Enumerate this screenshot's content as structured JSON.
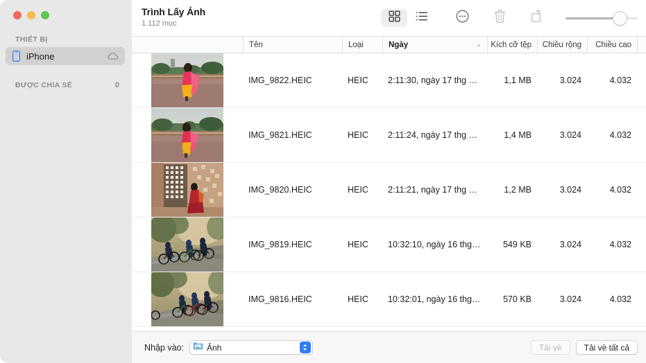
{
  "window": {
    "traffic_lights": [
      {
        "name": "close",
        "color": "#ec6a5e"
      },
      {
        "name": "minimize",
        "color": "#f4bd4f"
      },
      {
        "name": "maximize",
        "color": "#61c554"
      }
    ]
  },
  "sidebar": {
    "sections": [
      {
        "label": "THIẾT BỊ",
        "badge": "",
        "items": [
          {
            "label": "iPhone",
            "icon": "iphone-icon",
            "accessory": "cloud-icon",
            "selected": true
          }
        ]
      },
      {
        "label": "ĐƯỢC CHIA SẺ",
        "badge": "0",
        "items": []
      }
    ]
  },
  "header": {
    "title": "Trình Lấy Ảnh",
    "subtitle": "1.112 mục"
  },
  "toolbar": {
    "buttons": [
      {
        "name": "grid-view-icon",
        "label": "Dạng lưới",
        "selected": true,
        "disabled": false
      },
      {
        "name": "list-view-icon",
        "label": "Dạng danh sách",
        "selected": false,
        "disabled": false
      },
      {
        "name": "more-options-icon",
        "label": "Tùy chọn khác",
        "selected": false,
        "disabled": false
      },
      {
        "name": "trash-icon",
        "label": "Xóa",
        "selected": false,
        "disabled": true
      },
      {
        "name": "rotate-icon",
        "label": "Xoay",
        "selected": false,
        "disabled": true
      }
    ],
    "zoom_slider": {
      "name": "thumbnail-size-slider",
      "value": 80,
      "min": 0,
      "max": 100
    }
  },
  "table": {
    "columns": [
      {
        "key": "thumb",
        "label": "",
        "sorted": false,
        "align": "left"
      },
      {
        "key": "name",
        "label": "Tên",
        "sorted": false,
        "align": "left"
      },
      {
        "key": "type",
        "label": "Loại",
        "sorted": false,
        "align": "left"
      },
      {
        "key": "date",
        "label": "Ngày",
        "sorted": true,
        "align": "left",
        "sort_chevron": "⌄"
      },
      {
        "key": "size",
        "label": "Kích cỡ tệp",
        "sorted": false,
        "align": "right"
      },
      {
        "key": "width",
        "label": "Chiều rộng",
        "sorted": false,
        "align": "right"
      },
      {
        "key": "height",
        "label": "Chiều cao",
        "sorted": false,
        "align": "right"
      }
    ],
    "rows": [
      {
        "name": "IMG_9822.HEIC",
        "type": "HEIC",
        "date": "2:11:30, ngày 17 thg 9, …",
        "size": "1,1 MB",
        "width": "3.024",
        "height": "4.032",
        "thumb": "sari-terrace-wide"
      },
      {
        "name": "IMG_9821.HEIC",
        "type": "HEIC",
        "date": "2:11:24, ngày 17 thg 9, …",
        "size": "1,4 MB",
        "width": "3.024",
        "height": "4.032",
        "thumb": "sari-terrace-wide"
      },
      {
        "name": "IMG_9820.HEIC",
        "type": "HEIC",
        "date": "2:11:21, ngày 17 thg 9, …",
        "size": "1,2 MB",
        "width": "3.024",
        "height": "4.032",
        "thumb": "sari-lattice-window"
      },
      {
        "name": "IMG_9819.HEIC",
        "type": "HEIC",
        "date": "10:32:10, ngày 16 thg 9, …",
        "size": "549 KB",
        "width": "3.024",
        "height": "4.032",
        "thumb": "cyclists-road"
      },
      {
        "name": "IMG_9816.HEIC",
        "type": "HEIC",
        "date": "10:32:01, ngày 16 thg 9, …",
        "size": "570 KB",
        "width": "3.024",
        "height": "4.032",
        "thumb": "cyclists-road"
      }
    ]
  },
  "bottom_bar": {
    "import_label": "Nhập vào:",
    "destination": {
      "value": "Ảnh",
      "icon": "photos-folder-icon"
    },
    "download_button": {
      "label": "Tải về",
      "disabled": true
    },
    "download_all_button": {
      "label": "Tải về tất cả",
      "disabled": false
    }
  }
}
